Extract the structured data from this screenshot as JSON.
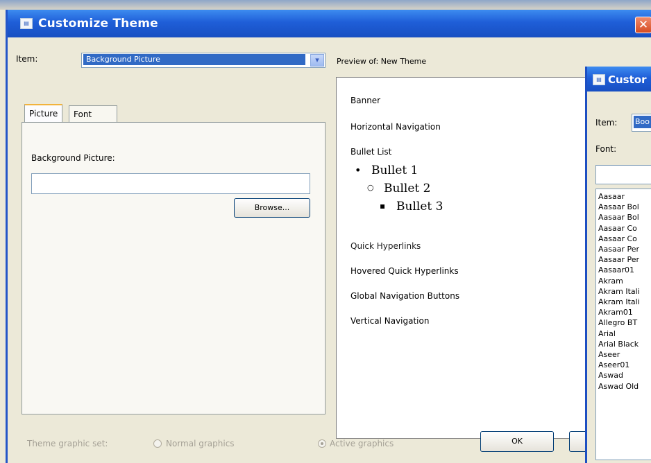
{
  "dialog": {
    "title": "Customize Theme",
    "icon": "window-icon",
    "item_label": "Item:",
    "item_value": "Background Picture",
    "preview_label": "Preview of: New Theme",
    "tabs": [
      "Picture",
      "Font"
    ],
    "picture_tab": {
      "field_label": "Background Picture:",
      "field_value": "",
      "browse_label": "Browse..."
    },
    "preview_items": {
      "banner": "Banner",
      "horizontal_navigation": "Horizontal Navigation",
      "bullet_list": "Bullet List",
      "bullets": [
        "Bullet 1",
        "Bullet 2",
        "Bullet 3"
      ],
      "bullet_markers": [
        "•",
        "○",
        "▪"
      ],
      "quick_hyperlinks": "Quick Hyperlinks",
      "hovered_quick_hyperlinks": "Hovered Quick Hyperlinks",
      "global_navigation_buttons": "Global Navigation Buttons",
      "vertical_navigation": "Vertical Navigation"
    },
    "graphics_set": {
      "label": "Theme graphic set:",
      "normal": "Normal graphics",
      "active": "Active graphics",
      "selected": "active"
    },
    "ok_label": "OK"
  },
  "second_dialog": {
    "title_partial": "Custor",
    "item_label": "Item:",
    "item_value_partial": "Boo",
    "font_label": "Font:",
    "font_value": "",
    "fonts": [
      "Aasaar",
      "Aasaar Bol",
      "Aasaar Bol",
      "Aasaar Co",
      "Aasaar Co",
      "Aasaar Per",
      "Aasaar Per",
      "Aasaar01",
      "Akram",
      "Akram Itali",
      "Akram Itali",
      "Akram01",
      "Allegro BT",
      "Arial",
      "Arial Black",
      "Aseer",
      "Aseer01",
      "Aswad",
      "Aswad Old"
    ]
  }
}
